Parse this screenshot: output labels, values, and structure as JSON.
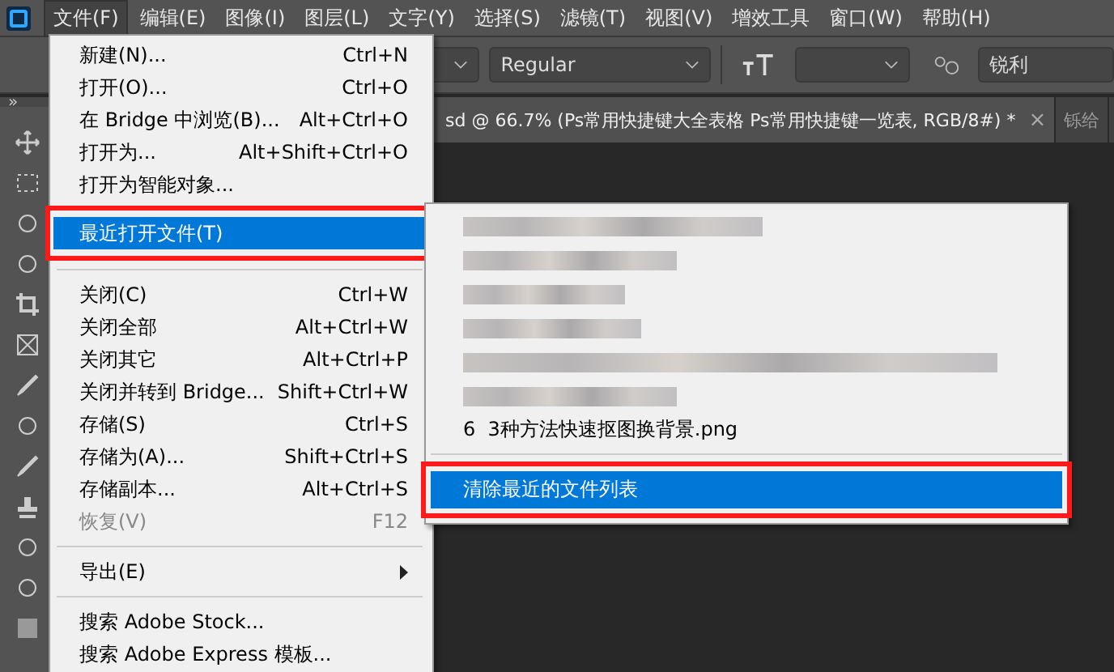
{
  "menu_bar": [
    {
      "label": "文件(F)",
      "selected": true
    },
    {
      "label": "编辑(E)",
      "selected": false
    },
    {
      "label": "图像(I)",
      "selected": false
    },
    {
      "label": "图层(L)",
      "selected": false
    },
    {
      "label": "文字(Y)",
      "selected": false
    },
    {
      "label": "选择(S)",
      "selected": false
    },
    {
      "label": "滤镜(T)",
      "selected": false
    },
    {
      "label": "视图(V)",
      "selected": false
    },
    {
      "label": "增效工具",
      "selected": false
    },
    {
      "label": "窗口(W)",
      "selected": false
    },
    {
      "label": "帮助(H)",
      "selected": false
    }
  ],
  "options_bar": {
    "font_style": "Regular",
    "antialias": "锐利"
  },
  "document_tabs": [
    {
      "title": "sd @ 66.7% (Ps常用快捷键大全表格 Ps常用快捷键一览表, RGB/8#) *",
      "close": "×",
      "selected": true
    },
    {
      "title": "铄给",
      "selected": false
    }
  ],
  "collapse_glyph": "»",
  "file_menu": [
    {
      "kind": "item",
      "label": "新建(N)...",
      "shortcut": "Ctrl+N",
      "selected": false,
      "disabled": false
    },
    {
      "kind": "item",
      "label": "打开(O)...",
      "shortcut": "Ctrl+O",
      "selected": false,
      "disabled": false
    },
    {
      "kind": "item",
      "label": "在 Bridge 中浏览(B)...",
      "shortcut": "Alt+Ctrl+O",
      "selected": false,
      "disabled": false
    },
    {
      "kind": "item",
      "label": "打开为...",
      "shortcut": "Alt+Shift+Ctrl+O",
      "selected": false,
      "disabled": false
    },
    {
      "kind": "item",
      "label": "打开为智能对象...",
      "selected": false,
      "disabled": false
    },
    {
      "kind": "item",
      "label": "最近打开文件(T)",
      "selected": true,
      "disabled": false,
      "annotated": true
    },
    {
      "kind": "separator"
    },
    {
      "kind": "item",
      "label": "关闭(C)",
      "shortcut": "Ctrl+W",
      "selected": false,
      "disabled": false
    },
    {
      "kind": "item",
      "label": "关闭全部",
      "shortcut": "Alt+Ctrl+W",
      "selected": false,
      "disabled": false
    },
    {
      "kind": "item",
      "label": "关闭其它",
      "shortcut": "Alt+Ctrl+P",
      "selected": false,
      "disabled": false
    },
    {
      "kind": "item",
      "label": "关闭并转到 Bridge...",
      "shortcut": "Shift+Ctrl+W",
      "selected": false,
      "disabled": false
    },
    {
      "kind": "item",
      "label": "存储(S)",
      "shortcut": "Ctrl+S",
      "selected": false,
      "disabled": false
    },
    {
      "kind": "item",
      "label": "存储为(A)...",
      "shortcut": "Shift+Ctrl+S",
      "selected": false,
      "disabled": false
    },
    {
      "kind": "item",
      "label": "存储副本...",
      "shortcut": "Alt+Ctrl+S",
      "selected": false,
      "disabled": false
    },
    {
      "kind": "item",
      "label": "恢复(V)",
      "shortcut": "F12",
      "selected": false,
      "disabled": true
    },
    {
      "kind": "separator"
    },
    {
      "kind": "submenu",
      "label": "导出(E)",
      "selected": false,
      "disabled": false
    },
    {
      "kind": "separator"
    },
    {
      "kind": "item",
      "label": "搜索 Adobe Stock...",
      "selected": false,
      "disabled": false
    },
    {
      "kind": "item",
      "label": "搜索 Adobe Express 模板...",
      "selected": false,
      "disabled": false
    }
  ],
  "recent_files_menu": [
    {
      "kind": "blurred"
    },
    {
      "kind": "blurred"
    },
    {
      "kind": "blurred"
    },
    {
      "kind": "blurred"
    },
    {
      "kind": "blurred"
    },
    {
      "kind": "blurred"
    },
    {
      "kind": "file",
      "number": "6",
      "label": "3种方法快速抠图换背景.png",
      "selected": false
    },
    {
      "kind": "separator"
    },
    {
      "kind": "action",
      "label": "清除最近的文件列表",
      "selected": true,
      "annotated": true
    }
  ]
}
